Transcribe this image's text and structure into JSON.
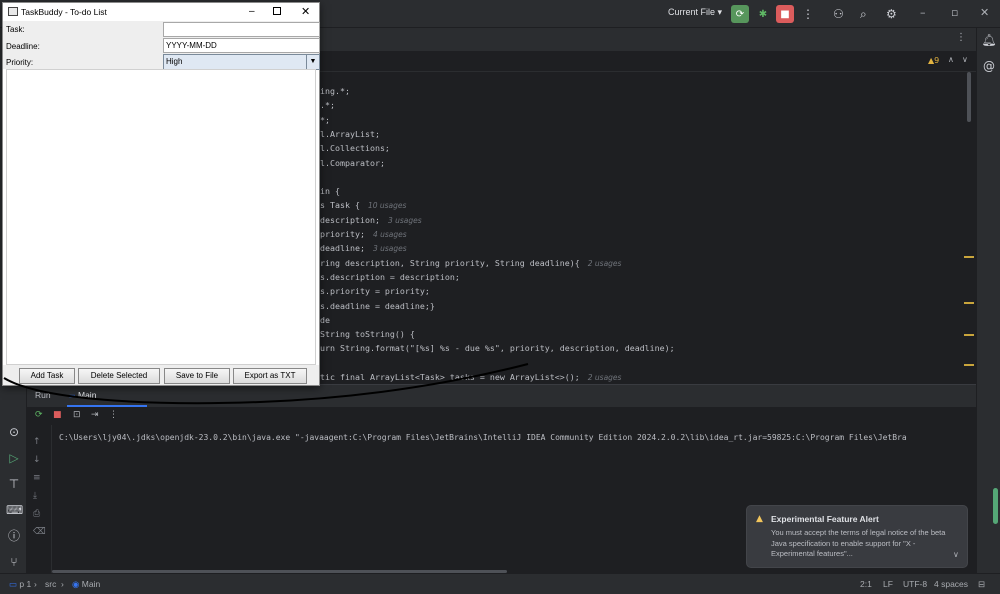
{
  "ide": {
    "run_config": "Current File",
    "code_lines": [
      {
        "t": "ing.*;"
      },
      {
        "t": ".*;"
      },
      {
        "t": "*;"
      },
      {
        "t": "l.ArrayList;"
      },
      {
        "t": "l.Collections;"
      },
      {
        "t": "l.Comparator;"
      },
      {
        "t": ""
      },
      {
        "t": "in {"
      },
      {
        "t": "s Task {",
        "hint": "10 usages"
      },
      {
        "t": "description;",
        "hint": "3 usages"
      },
      {
        "t": "priority;",
        "hint": "4 usages"
      },
      {
        "t": "deadline;",
        "hint": "3 usages"
      },
      {
        "t": "ring description, String priority, String deadline){",
        "hint": "2 usages"
      },
      {
        "t": "s.description = description;"
      },
      {
        "t": "s.priority = priority;"
      },
      {
        "t": "s.deadline = deadline;}"
      },
      {
        "t": "de"
      },
      {
        "t": "String toString() {"
      },
      {
        "t": "urn String.format(\"[%s] %s - due %s\", priority, description, deadline);"
      },
      {
        "t": ""
      },
      {
        "t": "tic final ArrayList<Task> tasks = new ArrayList<>();",
        "hint": "2 usages"
      }
    ],
    "warn_count": "▲9",
    "run_tabs": {
      "run": "Run",
      "main": "Main"
    },
    "console_line": "C:\\Users\\ljy04\\.jdks\\openjdk-23.0.2\\bin\\java.exe \"-javaagent:C:\\Program Files\\JetBrains\\IntelliJ IDEA Community Edition 2024.2.0.2\\lib\\idea_rt.jar=59825:C:\\Program Files\\JetBra",
    "notification": {
      "title": "Experimental Feature Alert",
      "body": "You must accept the terms of legal notice of the beta Java specification to enable support for \"X - Experimental features\"..."
    },
    "statusbar": {
      "breadcrumb_project": "p 1",
      "breadcrumb_src": "src",
      "breadcrumb_main": "Main",
      "position": "2:1",
      "line_sep": "LF",
      "encoding": "UTF-8",
      "indent": "4 spaces"
    }
  },
  "taskbuddy": {
    "title": "TaskBuddy - To-do List",
    "task_label": "Task:",
    "task_value": "",
    "deadline_label": "Deadline:",
    "deadline_value": "YYYY-MM-DD",
    "priority_label": "Priority:",
    "priority_value": "High",
    "buttons": {
      "add": "Add Task",
      "delete": "Delete Selected",
      "save": "Save to File",
      "export": "Export as TXT"
    }
  },
  "colors": {
    "ide_bg": "#1e1f22",
    "panel_bg": "#2b2d30",
    "accent_blue": "#3574f0",
    "run_green": "#57965c",
    "stop_red": "#db5c5c",
    "warning_yellow": "#f2c55c"
  }
}
